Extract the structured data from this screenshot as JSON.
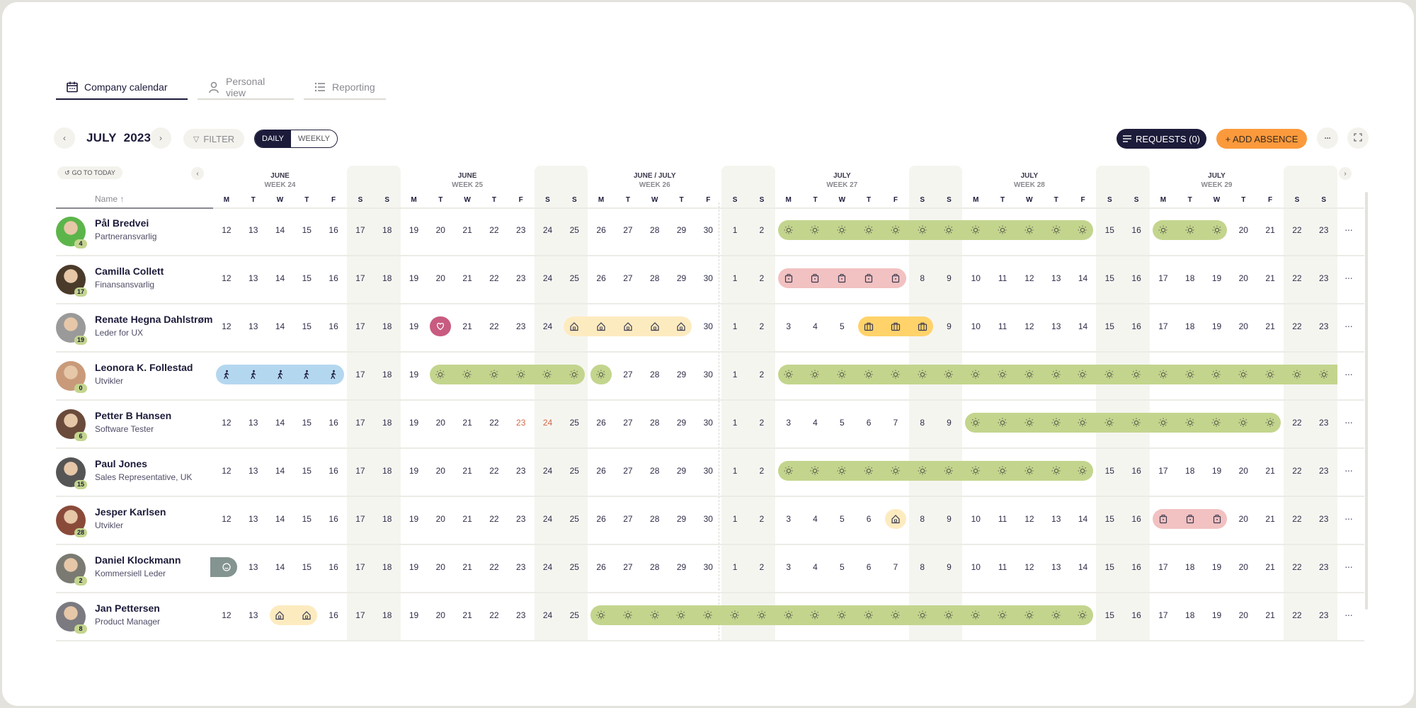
{
  "tabs": [
    {
      "label": "Company calendar",
      "icon": "calendar-icon",
      "active": true
    },
    {
      "label": "Personal view",
      "icon": "person-icon",
      "active": false
    },
    {
      "label": "Reporting",
      "icon": "list-icon",
      "active": false
    }
  ],
  "toolbar": {
    "month": "JULY",
    "year": "2023",
    "filter_label": "FILTER",
    "view_options": [
      "DAILY",
      "WEEKLY"
    ],
    "view_selected": "DAILY",
    "requests_label": "REQUESTS (0)",
    "add_absence_label": "+ ADD ABSENCE",
    "go_to_today_label": "GO TO TODAY",
    "prev_icon": "chevron-left-icon",
    "next_icon": "chevron-right-icon",
    "more_icon": "more-horizontal-icon",
    "fullscreen_icon": "expand-icon"
  },
  "grid": {
    "name_header": "Name ↑",
    "weeks": [
      {
        "month": "JUNE",
        "week": "WEEK 24"
      },
      {
        "month": "JUNE",
        "week": "WEEK 25"
      },
      {
        "month": "JUNE / JULY",
        "week": "WEEK 26"
      },
      {
        "month": "JULY",
        "week": "WEEK 27"
      },
      {
        "month": "JULY",
        "week": "WEEK 28"
      },
      {
        "month": "JULY",
        "week": "WEEK 29"
      }
    ],
    "days_of_week": [
      "M",
      "T",
      "W",
      "T",
      "F",
      "S",
      "S"
    ],
    "dates": [
      12,
      13,
      14,
      15,
      16,
      17,
      18,
      19,
      20,
      21,
      22,
      23,
      24,
      25,
      26,
      27,
      28,
      29,
      30,
      1,
      2,
      3,
      4,
      5,
      6,
      7,
      8,
      9,
      10,
      11,
      12,
      13,
      14,
      15,
      16,
      17,
      18,
      19,
      20,
      21,
      22,
      23
    ]
  },
  "absence_types": {
    "vacation": {
      "color": "#c3d58d",
      "icon": "sun-icon"
    },
    "sick": {
      "color": "#f2c1c1",
      "icon": "medkit-icon"
    },
    "home_office": {
      "color": "#fdebc0",
      "icon": "house-icon"
    },
    "travel": {
      "color": "#ffd36a",
      "icon": "briefcase-icon"
    },
    "course": {
      "color": "#b4d7f0",
      "icon": "walking-icon"
    },
    "care": {
      "color": "#c85b80",
      "icon": "heart-hand-icon"
    },
    "other": {
      "color": "#849490",
      "icon": "chat-icon"
    }
  },
  "people": [
    {
      "name": "Pål Bredvei",
      "role": "Partneransvarlig",
      "badge": "4",
      "avatar_color": "#5cb54a",
      "absences": [
        {
          "type": "vacation",
          "start": 21,
          "end": 32
        },
        {
          "type": "vacation",
          "start": 35,
          "end": 37
        }
      ],
      "red_days": []
    },
    {
      "name": "Camilla Collett",
      "role": "Finansansvarlig",
      "badge": "17",
      "avatar_color": "#4a3a2a",
      "absences": [
        {
          "type": "sick",
          "start": 21,
          "end": 25
        }
      ],
      "red_days": []
    },
    {
      "name": "Renate Hegna Dahlstrøm",
      "role": "Leder for UX",
      "badge": "19",
      "avatar_color": "#9a9a9a",
      "absences": [
        {
          "type": "care",
          "start": 8,
          "end": 8
        },
        {
          "type": "home_office",
          "start": 13,
          "end": 17
        },
        {
          "type": "travel",
          "start": 24,
          "end": 26
        }
      ],
      "red_days": []
    },
    {
      "name": "Leonora K. Follestad",
      "role": "Utvikler",
      "badge": "0",
      "avatar_color": "#c99a7a",
      "absences": [
        {
          "type": "course",
          "start": 0,
          "end": 4
        },
        {
          "type": "vacation",
          "start": 8,
          "end": 13
        },
        {
          "type": "vacation",
          "start": 14,
          "end": 14
        },
        {
          "type": "vacation",
          "start": 21,
          "end": 41,
          "continues": true
        }
      ],
      "red_days": []
    },
    {
      "name": "Petter B Hansen",
      "role": "Software Tester",
      "badge": "6",
      "avatar_color": "#6a4a3a",
      "absences": [
        {
          "type": "vacation",
          "start": 28,
          "end": 39
        }
      ],
      "red_days": [
        11,
        12
      ]
    },
    {
      "name": "Paul Jones",
      "role": "Sales Representative, UK",
      "badge": "15",
      "avatar_color": "#555555",
      "absences": [
        {
          "type": "vacation",
          "start": 21,
          "end": 32
        }
      ],
      "red_days": []
    },
    {
      "name": "Jesper Karlsen",
      "role": "Utvikler",
      "badge": "28",
      "avatar_color": "#8a4a3a",
      "absences": [
        {
          "type": "home_office",
          "start": 25,
          "end": 25
        },
        {
          "type": "sick",
          "start": 35,
          "end": 37
        }
      ],
      "red_days": []
    },
    {
      "name": "Daniel Klockmann",
      "role": "Kommersiell Leder",
      "badge": "2",
      "avatar_color": "#7a7a72",
      "absences": [
        {
          "type": "other",
          "start": 0,
          "end": 0,
          "continues_left": true
        }
      ],
      "red_days": []
    },
    {
      "name": "Jan Pettersen",
      "role": "Product Manager",
      "badge": "8",
      "avatar_color": "#7a7a80",
      "absences": [
        {
          "type": "home_office",
          "start": 2,
          "end": 3
        },
        {
          "type": "vacation",
          "start": 14,
          "end": 32
        }
      ],
      "red_days": []
    }
  ]
}
